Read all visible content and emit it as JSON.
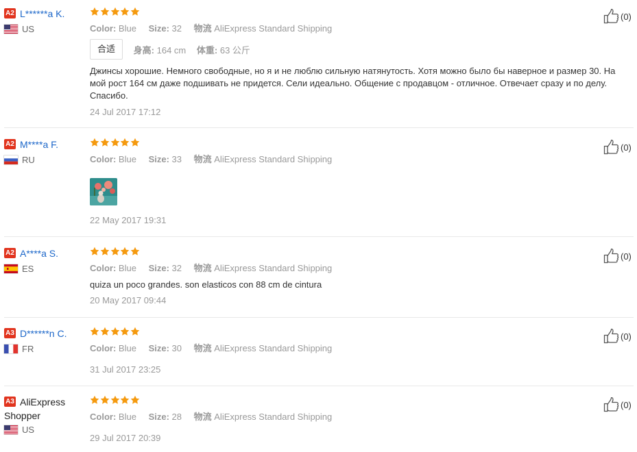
{
  "reviews": [
    {
      "level": "A2",
      "name": "L******a K.",
      "country": "US",
      "rating": 5,
      "attrs": {
        "color_key": "Color:",
        "color_val": "Blue",
        "size_key": "Size:",
        "size_val": "32",
        "ship_key": "物流",
        "ship_val": "AliExpress Standard Shipping"
      },
      "fit": {
        "label": "合适",
        "height_key": "身高:",
        "height_val": "164 cm",
        "weight_key": "体重:",
        "weight_val": "63 公斤"
      },
      "text": "Джинсы хорошие. Немного свободные, но я и не люблю сильную натянутость. Хотя можно было бы наверное и размер 30. На мой рост 164 см даже подшивать не придется. Сели идеально. Общение с продавцом - отличное. Отвечает сразу и по делу. Спасибо.",
      "date": "24 Jul 2017 17:12",
      "useful": "(0)"
    },
    {
      "level": "A2",
      "name": "M****a F.",
      "country": "RU",
      "rating": 5,
      "attrs": {
        "color_key": "Color:",
        "color_val": "Blue",
        "size_key": "Size:",
        "size_val": "33",
        "ship_key": "物流",
        "ship_val": "AliExpress Standard Shipping"
      },
      "date": "22 May 2017 19:31",
      "useful": "(0)"
    },
    {
      "level": "A2",
      "name": "A****a S.",
      "country": "ES",
      "rating": 5,
      "attrs": {
        "color_key": "Color:",
        "color_val": "Blue",
        "size_key": "Size:",
        "size_val": "32",
        "ship_key": "物流",
        "ship_val": "AliExpress Standard Shipping"
      },
      "text": "quiza un poco grandes. son elasticos con 88 cm de cintura",
      "date": "20 May 2017 09:44",
      "useful": "(0)"
    },
    {
      "level": "A3",
      "name": "D******n C.",
      "country": "FR",
      "rating": 5,
      "attrs": {
        "color_key": "Color:",
        "color_val": "Blue",
        "size_key": "Size:",
        "size_val": "30",
        "ship_key": "物流",
        "ship_val": "AliExpress Standard Shipping"
      },
      "date": "31 Jul 2017 23:25",
      "useful": "(0)"
    },
    {
      "level": "A3",
      "name_line1": "AliExpress",
      "name_line2": "Shopper",
      "country": "US",
      "rating": 5,
      "attrs": {
        "color_key": "Color:",
        "color_val": "Blue",
        "size_key": "Size:",
        "size_val": "28",
        "ship_key": "物流",
        "ship_val": "AliExpress Standard Shipping"
      },
      "date": "29 Jul 2017 20:39",
      "useful": "(0)"
    }
  ],
  "colors": {
    "level_badge": "#e1341e",
    "buyer_name": "#1b66c9",
    "star": "#f59a0f",
    "muted": "#999999",
    "separator": "#e8e8e8"
  }
}
